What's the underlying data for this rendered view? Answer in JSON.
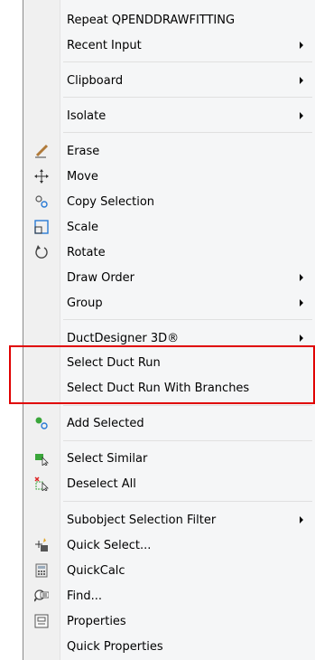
{
  "menu": {
    "repeat": "Repeat QPENDDRAWFITTING",
    "recent_input": "Recent Input",
    "clipboard": "Clipboard",
    "isolate": "Isolate",
    "erase": "Erase",
    "move": "Move",
    "copy_selection": "Copy Selection",
    "scale": "Scale",
    "rotate": "Rotate",
    "draw_order": "Draw Order",
    "group": "Group",
    "ductdesigner": "DuctDesigner 3D®",
    "select_duct_run": "Select Duct Run",
    "select_duct_run_branches": "Select Duct Run With Branches",
    "add_selected": "Add Selected",
    "select_similar": "Select Similar",
    "deselect_all": "Deselect All",
    "subobject_filter": "Subobject Selection Filter",
    "quick_select": "Quick Select...",
    "quickcalc": "QuickCalc",
    "find": "Find...",
    "properties": "Properties",
    "quick_properties": "Quick Properties"
  },
  "colors": {
    "highlight_border": "#e00000",
    "menu_background": "#f5f6f7"
  }
}
